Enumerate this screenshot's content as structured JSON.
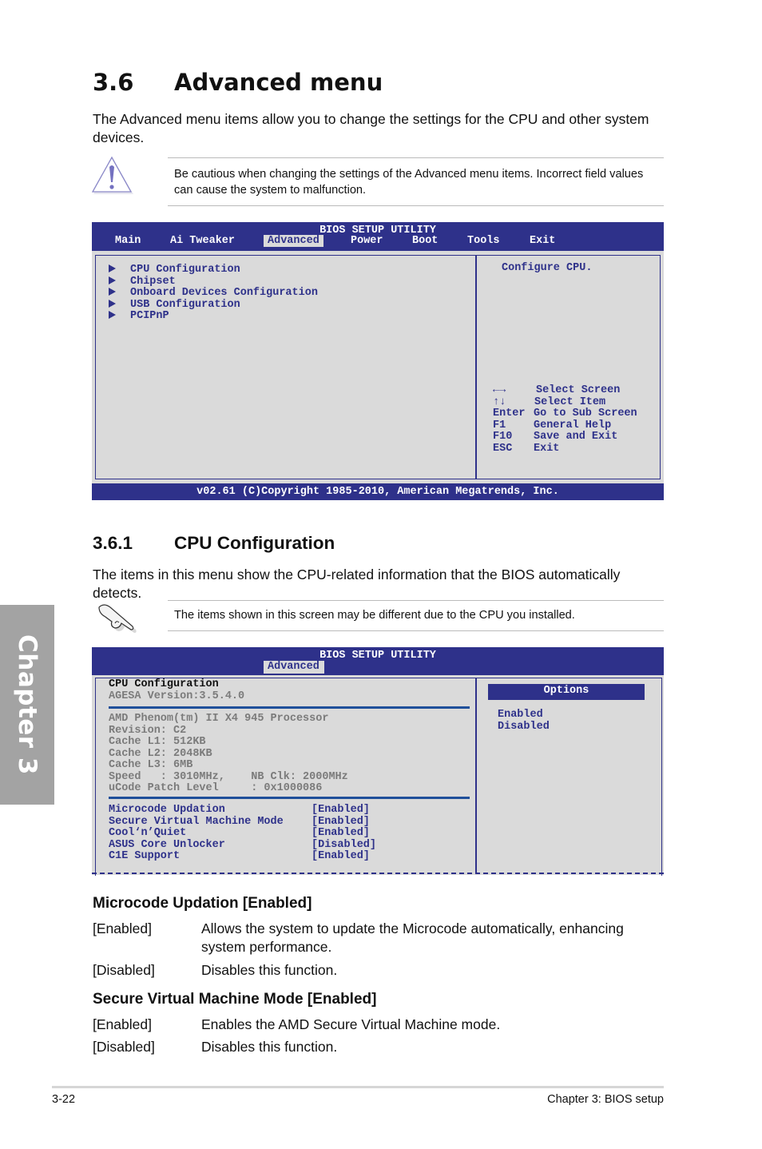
{
  "chapter_tab": "Chapter 3",
  "section": {
    "number": "3.6",
    "title": "Advanced menu",
    "intro": "The Advanced menu items allow you to change the settings for the CPU and other system devices.",
    "caution": "Be cautious when changing the settings of the Advanced menu items. Incorrect field values can cause the system to malfunction."
  },
  "bios1": {
    "title": "BIOS SETUP UTILITY",
    "tabs": [
      "Main",
      "Ai Tweaker",
      "Advanced",
      "Power",
      "Boot",
      "Tools",
      "Exit"
    ],
    "active_tab": "Advanced",
    "items": [
      "CPU Configuration",
      "Chipset",
      "Onboard Devices Configuration",
      "USB Configuration",
      "PCIPnP"
    ],
    "help": "Configure CPU.",
    "keys": [
      {
        "key": "←→",
        "action": "Select Screen"
      },
      {
        "key": "↑↓",
        "action": "Select Item"
      },
      {
        "key": "Enter",
        "action": "Go to Sub Screen"
      },
      {
        "key": "F1",
        "action": "General Help"
      },
      {
        "key": "F10",
        "action": "Save and Exit"
      },
      {
        "key": "ESC",
        "action": "Exit"
      }
    ],
    "footer": "v02.61 (C)Copyright 1985-2010, American Megatrends, Inc."
  },
  "subsection": {
    "number": "3.6.1",
    "title": "CPU Configuration",
    "intro": "The items in this menu show the CPU-related information that the BIOS automatically detects.",
    "note": "The items shown in this screen may be different due to the CPU you installed."
  },
  "bios2": {
    "title": "BIOS SETUP UTILITY",
    "active_tab": "Advanced",
    "heading": "CPU Configuration",
    "agesa": "AGESA Version:3.5.4.0",
    "cpu_info": [
      "AMD Phenom(tm) II X4 945 Processor",
      "Revision: C2",
      "Cache L1: 512KB",
      "Cache L2: 2048KB",
      "Cache L3: 6MB",
      "Speed   : 3010MHz,    NB Clk: 2000MHz",
      "uCode Patch Level     : 0x1000086"
    ],
    "settings": [
      {
        "label": "Microcode Updation",
        "value": "[Enabled]"
      },
      {
        "label": "Secure Virtual Machine Mode",
        "value": "[Enabled]"
      },
      {
        "label": "Cool‘n’Quiet",
        "value": "[Enabled]"
      },
      {
        "label": "ASUS Core Unlocker",
        "value": "[Disabled]"
      },
      {
        "label": "C1E Support",
        "value": "[Enabled]"
      }
    ],
    "options_title": "Options",
    "options": [
      "Enabled",
      "Disabled"
    ]
  },
  "options_doc": [
    {
      "title": "Microcode Updation [Enabled]",
      "rows": [
        {
          "key": "[Enabled]",
          "desc": "Allows the system to update the Microcode automatically, enhancing system performance."
        },
        {
          "key": "[Disabled]",
          "desc": "Disables this function."
        }
      ]
    },
    {
      "title": "Secure Virtual Machine Mode [Enabled]",
      "rows": [
        {
          "key": "[Enabled]",
          "desc": "Enables the AMD Secure Virtual Machine mode."
        },
        {
          "key": "[Disabled]",
          "desc": "Disables this function."
        }
      ]
    }
  ],
  "footer": {
    "page": "3-22",
    "chapter": "Chapter 3: BIOS setup"
  }
}
